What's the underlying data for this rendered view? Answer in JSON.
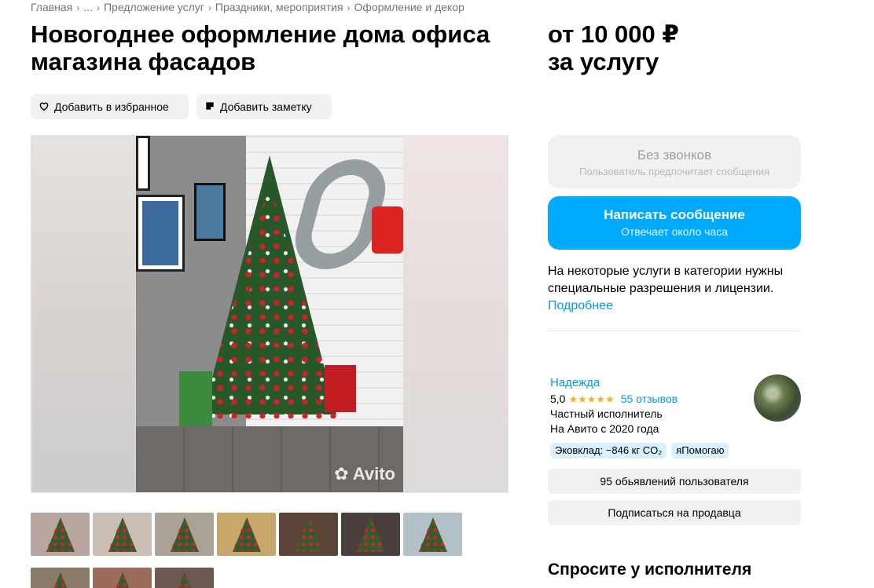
{
  "breadcrumbs": [
    "Главная",
    "...",
    "Предложение услуг",
    "Праздники, мероприятия",
    "Оформление и декор"
  ],
  "title": "Новогоднее оформление дома офиса магазина фасадов",
  "price": {
    "line1": "от 10 000 ₽",
    "line2": "за услугу"
  },
  "actions": {
    "favorite": "Добавить в избранное",
    "note": "Добавить заметку"
  },
  "gallery": {
    "watermark": "Avito",
    "thumbnail_count": 10,
    "active_index": 0
  },
  "contact": {
    "no_calls_title": "Без звонков",
    "no_calls_subtitle": "Пользователь предпочитает сообщения",
    "write_title": "Написать сообщение",
    "write_subtitle": "Отвечает около часа"
  },
  "license": {
    "text": "На некоторые услуги в категории нужны специальные разрешения и лицензии.",
    "link": "Подробнее"
  },
  "seller": {
    "name": "Надежда",
    "rating": "5,0",
    "stars": "★★★★★",
    "reviews": "55 отзывов",
    "type": "Частный исполнитель",
    "since": "На Авито с 2020 года",
    "badges": [
      "Эковклад: −846 кг CO₂",
      "яПомогаю"
    ],
    "ads_button": "95 обьявлений пользователя",
    "subscribe_button": "Подписаться на продавца"
  },
  "ask_section_title": "Спросите у исполнителя",
  "colors": {
    "accent": "#00aaff",
    "link": "#0099f7",
    "star": "#ffb021",
    "chip_bg": "#f2f1f0"
  }
}
